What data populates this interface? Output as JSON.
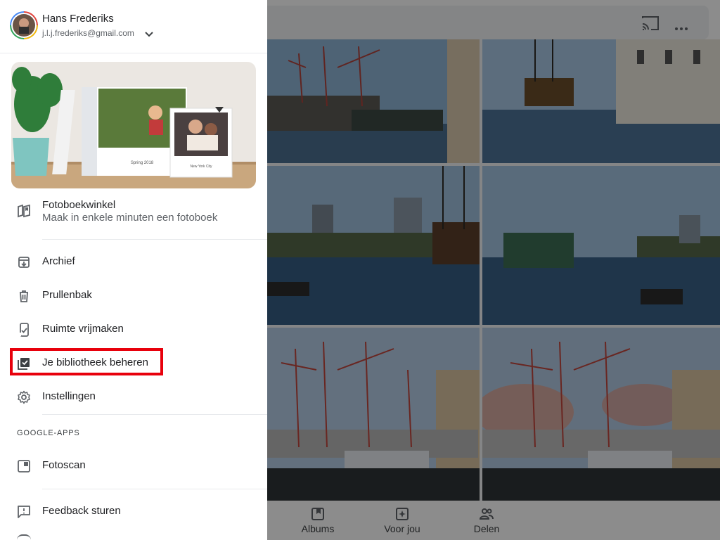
{
  "account": {
    "name": "Hans Frederiks",
    "email": "j.l.j.frederiks@gmail.com"
  },
  "promo": {
    "book_caption": "Spring 2018",
    "card_caption": "New York City"
  },
  "menu": {
    "photobook_title": "Fotoboekwinkel",
    "photobook_subtitle": "Maak in enkele minuten een fotoboek",
    "archive": "Archief",
    "trash": "Prullenbak",
    "free_space": "Ruimte vrijmaken",
    "manage_library": "Je bibliotheek beheren",
    "settings": "Instellingen",
    "section_google_apps": "GOOGLE-APPS",
    "fotoscan": "Fotoscan",
    "feedback": "Feedback sturen"
  },
  "bottom_nav": {
    "albums": "Albums",
    "for_you": "Voor jou",
    "share": "Delen"
  },
  "colors": {
    "highlight": "#e8000c",
    "drawer_bg": "#ffffff",
    "text_primary": "#202124",
    "text_secondary": "#5f6368"
  },
  "icons": {
    "top_bar": [
      "cast-icon",
      "more-icon"
    ],
    "menu": [
      "photobook-icon",
      "archive-icon",
      "trash-icon",
      "free-space-icon",
      "library-icon",
      "settings-icon",
      "fotoscan-icon",
      "feedback-icon"
    ],
    "bottom_nav": [
      "albums-icon",
      "for-you-icon",
      "share-icon"
    ]
  }
}
